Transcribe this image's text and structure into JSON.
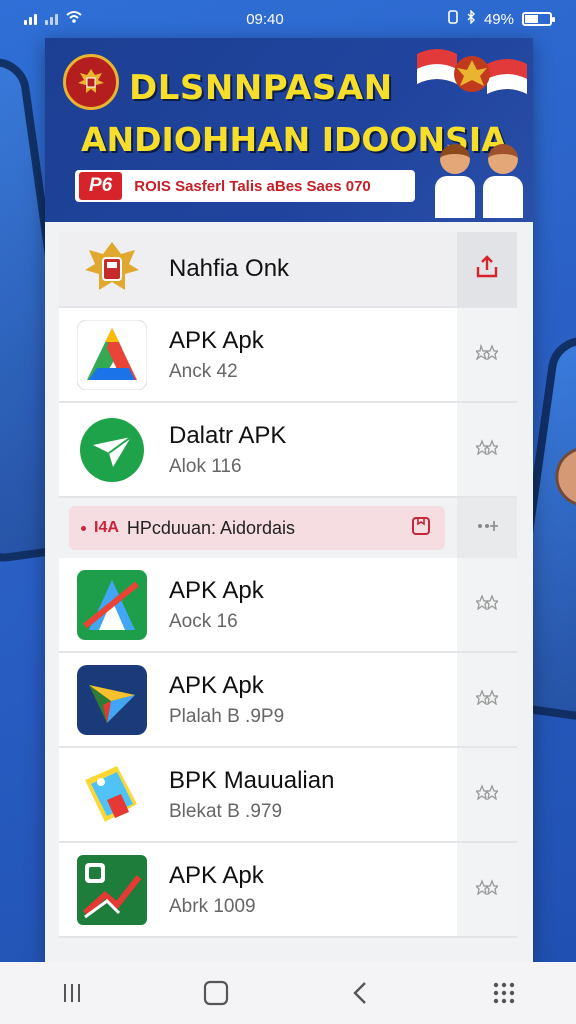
{
  "status_bar": {
    "time": "09:40",
    "battery_text": "49%",
    "battery_level": 0.49
  },
  "banner": {
    "title": "DLSNNPASAN",
    "subtitle": "ANDIOHHAN IDOONSIA",
    "badge": "P6",
    "strip_text": "ROIS Sasferl Talis aBes Saes 070"
  },
  "header_item": {
    "name": "Nahfia Onk",
    "icon": "emblem-icon",
    "action_icon": "share-icon",
    "accent": "#d7242b"
  },
  "apps": [
    {
      "name": "APK Apk",
      "sub": "Anck 42",
      "icon": "apk-icon-a"
    },
    {
      "name": "Dalatr APK",
      "sub": "Alok 116",
      "icon": "send-icon"
    }
  ],
  "promo": {
    "badge": "I4A",
    "text": "HPcduuan: Aidordais",
    "icon": "bookmark-icon"
  },
  "apps_more": [
    {
      "name": "APK Apk",
      "sub": "Aock 16",
      "icon": "apk-icon-b"
    },
    {
      "name": "APK Apk",
      "sub": "Plalah B .9P9",
      "icon": "paper-plane-icon"
    },
    {
      "name": "BPK Mauualian",
      "sub": "Blekat B .979",
      "icon": "photo-icon"
    },
    {
      "name": "APK Apk",
      "sub": "Abrk 1009",
      "icon": "chart-icon"
    }
  ],
  "colors": {
    "background": "#2a5fc4",
    "banner": "#1d3f93",
    "title_yellow": "#f6de2b",
    "promo_pink": "#f6dde2"
  }
}
